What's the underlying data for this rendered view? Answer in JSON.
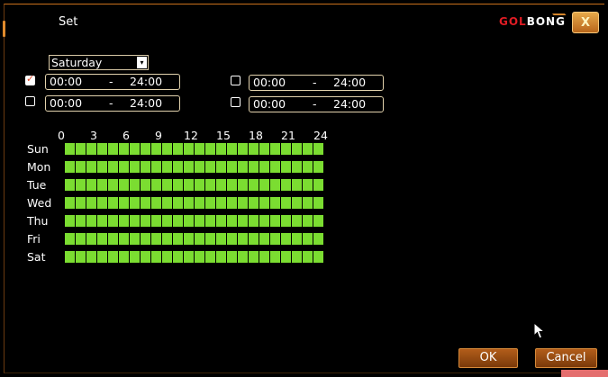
{
  "window": {
    "title": "Set",
    "brand_part1": "GOL",
    "brand_part2": "BONG",
    "close_label": "X"
  },
  "day_select": {
    "value": "Saturday",
    "arrow": "▾"
  },
  "periods": [
    {
      "enabled": true,
      "start": "00:00",
      "sep": "-",
      "end": "24:00"
    },
    {
      "enabled": false,
      "start": "00:00",
      "sep": "-",
      "end": "24:00"
    },
    {
      "enabled": false,
      "start": "00:00",
      "sep": "-",
      "end": "24:00"
    },
    {
      "enabled": false,
      "start": "00:00",
      "sep": "-",
      "end": "24:00"
    }
  ],
  "hours": [
    "0",
    "3",
    "6",
    "9",
    "12",
    "15",
    "18",
    "21",
    "24"
  ],
  "days": [
    "Sun",
    "Mon",
    "Tue",
    "Wed",
    "Thu",
    "Fri",
    "Sat"
  ],
  "schedule_fill": 1.0,
  "colors": {
    "accent": "#c9701c",
    "schedule": "#7bdd31",
    "check": "#e24b2a"
  },
  "buttons": {
    "ok": "OK",
    "cancel": "Cancel"
  }
}
